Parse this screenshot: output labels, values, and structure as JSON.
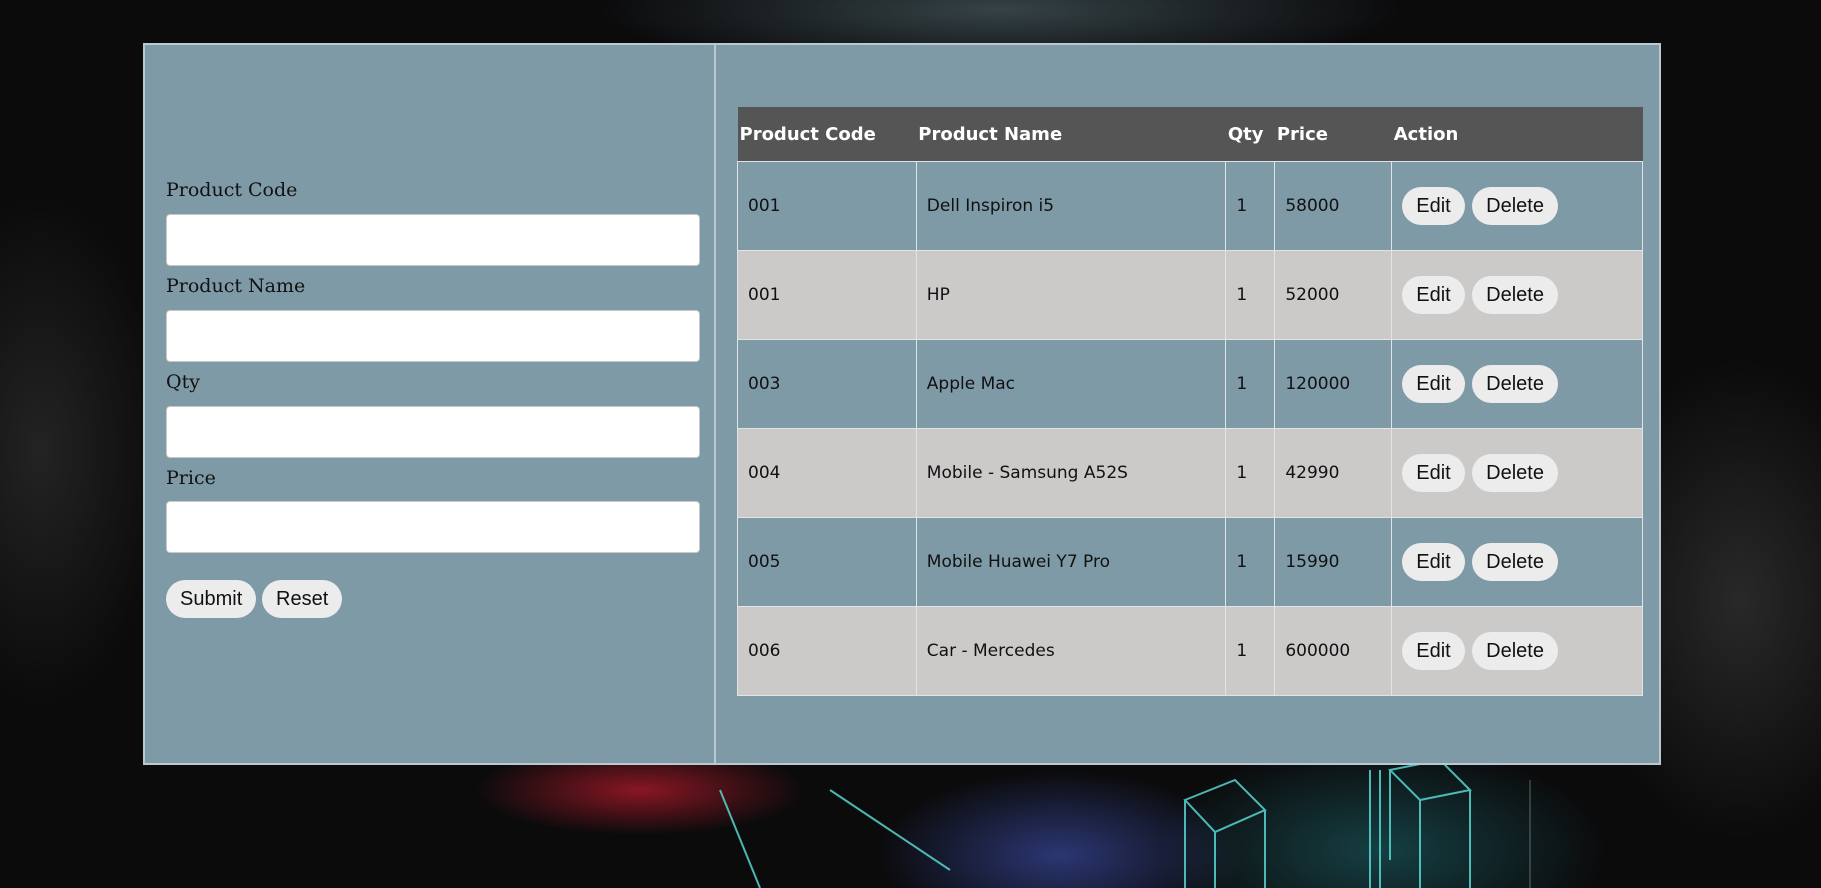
{
  "form": {
    "fields": [
      {
        "label": "Product Code",
        "value": "",
        "placeholder": ""
      },
      {
        "label": "Product Name",
        "value": "",
        "placeholder": ""
      },
      {
        "label": "Qty",
        "value": "",
        "placeholder": ""
      },
      {
        "label": "Price",
        "value": "",
        "placeholder": ""
      }
    ],
    "submit_label": "Submit",
    "reset_label": "Reset"
  },
  "table": {
    "headers": [
      "Product Code",
      "Product Name",
      "Qty",
      "Price",
      "Action"
    ],
    "edit_label": "Edit",
    "delete_label": "Delete",
    "rows": [
      {
        "code": "001",
        "name": "Dell Inspiron i5",
        "qty": "1",
        "price": "58000"
      },
      {
        "code": "001",
        "name": "HP",
        "qty": "1",
        "price": "52000"
      },
      {
        "code": "003",
        "name": "Apple Mac",
        "qty": "1",
        "price": "120000"
      },
      {
        "code": "004",
        "name": "Mobile - Samsung A52S",
        "qty": "1",
        "price": "42990"
      },
      {
        "code": "005",
        "name": "Mobile Huawei Y7 Pro",
        "qty": "1",
        "price": "15990"
      },
      {
        "code": "006",
        "name": "Car - Mercedes",
        "qty": "1",
        "price": "600000"
      }
    ]
  },
  "colors": {
    "panel_bg": "#7e9aa6",
    "header_bg": "#555555",
    "row_alt_bg": "#ccc9c9",
    "button_bg": "#ececec"
  }
}
